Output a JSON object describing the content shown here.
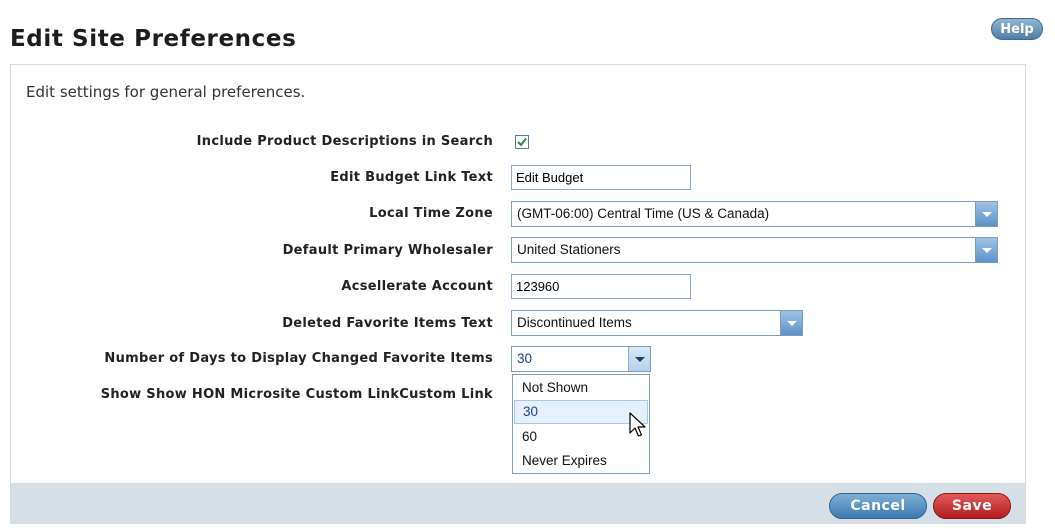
{
  "header": {
    "title": "Edit Site Preferences",
    "help_label": "Help"
  },
  "panel": {
    "intro": "Edit settings for general preferences."
  },
  "fields": {
    "include_descriptions": {
      "label": "Include Product Descriptions in Search",
      "checked": true
    },
    "budget_link": {
      "label": "Edit Budget Link Text",
      "value": "Edit Budget"
    },
    "time_zone": {
      "label": "Local Time Zone",
      "value": "(GMT-06:00) Central Time (US & Canada)"
    },
    "wholesaler": {
      "label": "Default Primary Wholesaler",
      "value": "United Stationers"
    },
    "account": {
      "label": "Acsellerate Account",
      "value": "123960"
    },
    "deleted_text": {
      "label": "Deleted Favorite Items Text",
      "value": "Discontinued Items"
    },
    "days_display": {
      "label": "Number of Days to Display Changed Favorite Items",
      "value": "30",
      "options": [
        "Not Shown",
        "30",
        "60",
        "Never Expires"
      ]
    },
    "hon_link": {
      "label": "Show Show HON Microsite Custom LinkCustom Link"
    }
  },
  "footer": {
    "cancel_label": "Cancel",
    "save_label": "Save"
  },
  "colors": {
    "help_button": "#5f8bb0",
    "cancel_button": "#4a86b8",
    "save_button": "#c62828",
    "footer_bar": "#d6dfe6",
    "checkmark": "#2e8b2e"
  },
  "icons": {
    "check": "check-icon",
    "dropdown": "chevron-down-icon",
    "cursor": "mouse-pointer-icon"
  }
}
